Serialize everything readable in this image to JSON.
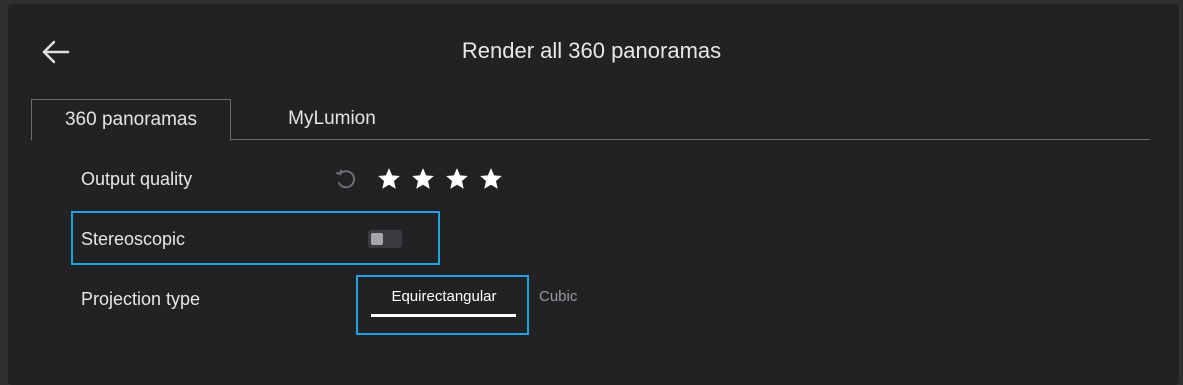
{
  "header": {
    "title": "Render all 360 panoramas",
    "back_icon": "arrow-left-icon"
  },
  "tabs": [
    {
      "label": "360 panoramas",
      "active": true
    },
    {
      "label": "MyLumion",
      "active": false
    }
  ],
  "settings": {
    "output_quality": {
      "label": "Output quality",
      "reset_icon": "reset-icon",
      "stars": 4,
      "max_stars": 4
    },
    "stereoscopic": {
      "label": "Stereoscopic",
      "enabled": false
    },
    "projection_type": {
      "label": "Projection type",
      "options": [
        "Equirectangular",
        "Cubic"
      ],
      "selected": "Equirectangular"
    }
  },
  "colors": {
    "highlight": "#1ea3e0",
    "background": "#222225"
  }
}
